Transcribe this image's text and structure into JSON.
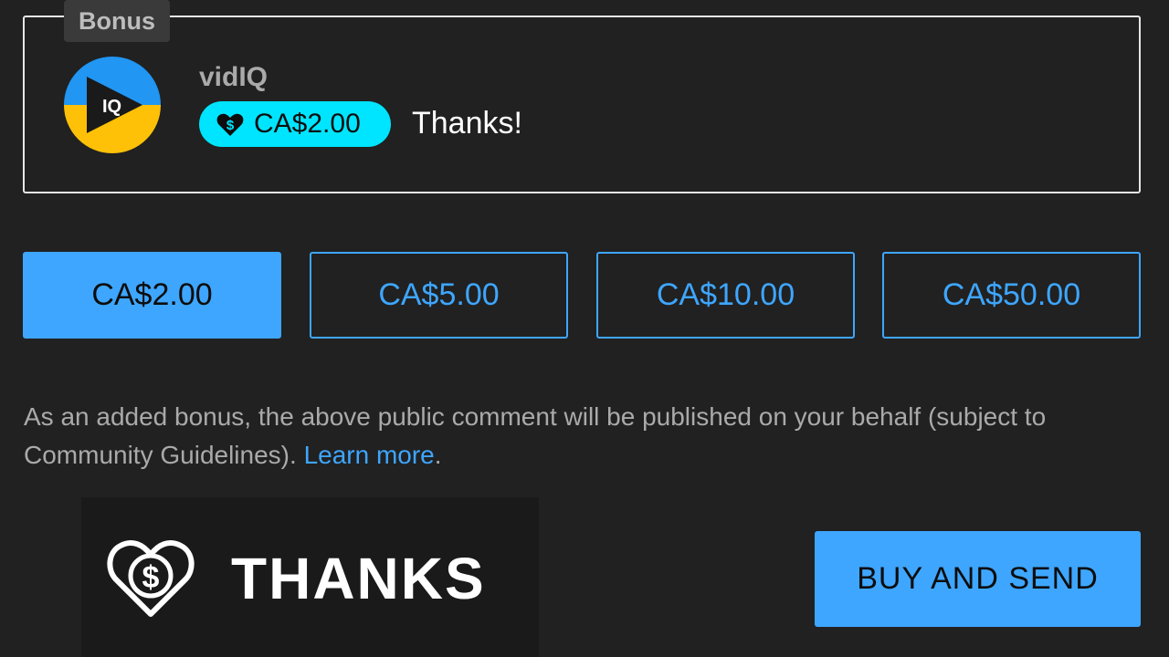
{
  "preview": {
    "section_label": "Bonus",
    "channel_name": "vidIQ",
    "avatar_text": "IQ",
    "pill_amount": "CA$2.00",
    "comment_text": "Thanks!"
  },
  "amount_options": [
    {
      "label": "CA$2.00",
      "selected": true
    },
    {
      "label": "CA$5.00",
      "selected": false
    },
    {
      "label": "CA$10.00",
      "selected": false
    },
    {
      "label": "CA$50.00",
      "selected": false
    }
  ],
  "disclaimer": {
    "text": "As an added bonus, the above public comment will be published on your behalf (subject to Community Guidelines). ",
    "link_text": "Learn more",
    "trailing": "."
  },
  "thanks_logo": {
    "word": "THANKS",
    "icon": "heart-dollar-icon"
  },
  "buy_button": {
    "label": "BUY AND SEND"
  },
  "colors": {
    "background": "#212121",
    "accent_blue": "#3ea6ff",
    "pill_cyan": "#00e5ff",
    "muted_text": "#aaaaaa"
  }
}
